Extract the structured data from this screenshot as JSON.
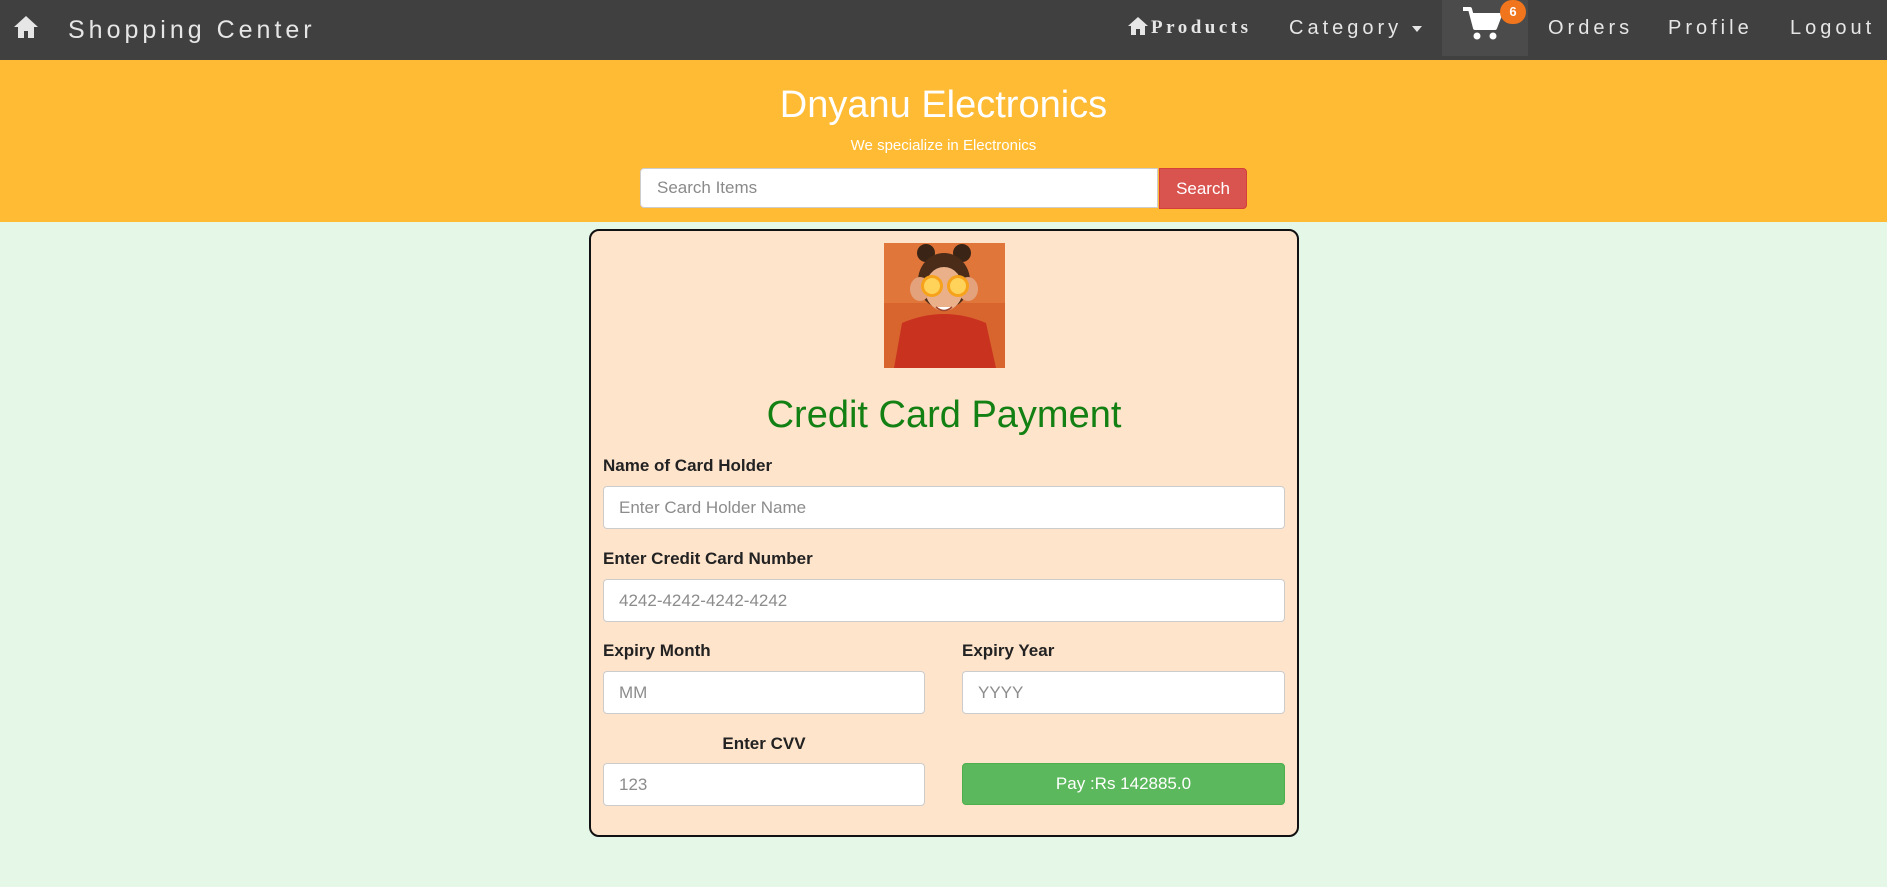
{
  "navbar": {
    "brand": "Shopping Center",
    "products_label": "Products",
    "category_label": "Category",
    "cart_count": "6",
    "orders_label": "Orders",
    "profile_label": "Profile",
    "logout_label": "Logout"
  },
  "banner": {
    "store_name": "Dnyanu Electronics",
    "tagline": "We specialize in Electronics",
    "search_placeholder": "Search Items",
    "search_button": "Search"
  },
  "payment": {
    "title": "Credit Card Payment",
    "holder_label": "Name of Card Holder",
    "holder_placeholder": "Enter Card Holder Name",
    "number_label": "Enter Credit Card Number",
    "number_placeholder": "4242-4242-4242-4242",
    "month_label": "Expiry Month",
    "month_placeholder": "MM",
    "year_label": "Expiry Year",
    "year_placeholder": "YYYY",
    "cvv_label": "Enter CVV",
    "cvv_placeholder": "123",
    "pay_button": "Pay :Rs 142885.0"
  },
  "colors": {
    "navbar_bg": "#404041",
    "banner_bg": "#ffbb33",
    "page_bg": "#e5f7e6",
    "card_bg": "#ffe4cc",
    "title_green": "#138013",
    "search_red": "#d9534f",
    "pay_green": "#5cb85c",
    "badge_orange": "#f0751c"
  },
  "icons": [
    "home-icon",
    "cart-icon"
  ]
}
